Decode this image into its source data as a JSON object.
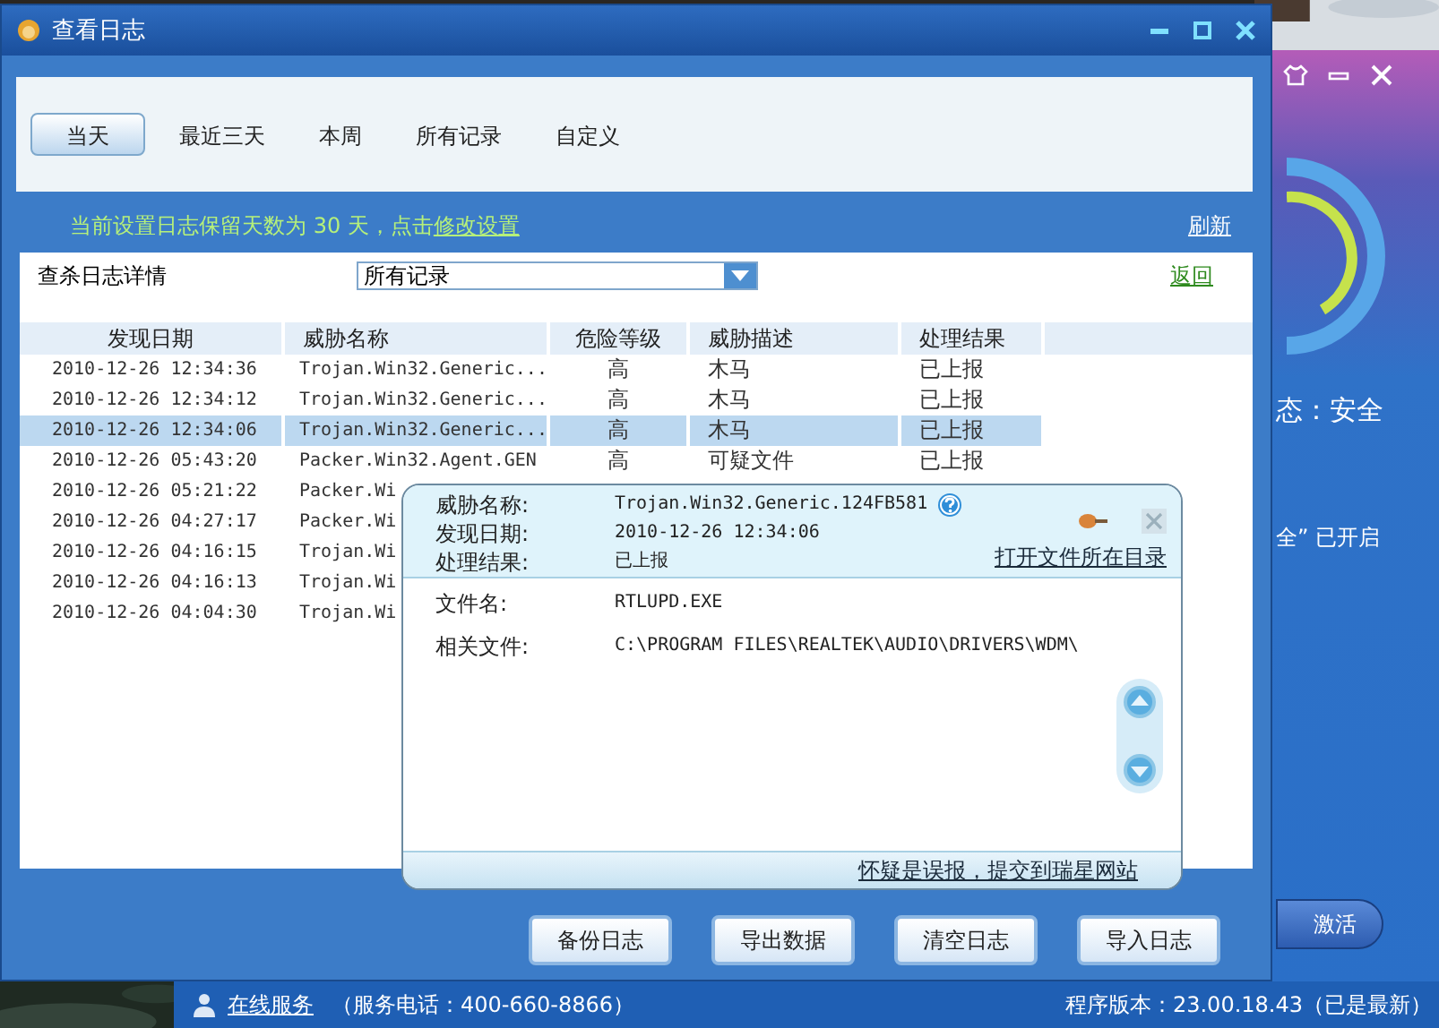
{
  "window": {
    "title": "查看日志"
  },
  "tabs": [
    {
      "label": "当天",
      "selected": true
    },
    {
      "label": "最近三天",
      "selected": false
    },
    {
      "label": "本周",
      "selected": false
    },
    {
      "label": "所有记录",
      "selected": false
    },
    {
      "label": "自定义",
      "selected": false
    }
  ],
  "notice": {
    "text": "当前设置日志保留天数为 30 天，点击",
    "link": "修改设置"
  },
  "refresh_link": "刷新",
  "filter": {
    "label": "查杀日志详情",
    "value": "所有记录"
  },
  "back_link": "返回",
  "table": {
    "columns": [
      "发现日期",
      "威胁名称",
      "危险等级",
      "威胁描述",
      "处理结果"
    ],
    "rows": [
      {
        "cells": [
          "2010-12-26 12:34:36",
          "Trojan.Win32.Generic...",
          "高",
          "木马",
          "已上报"
        ],
        "selected": false
      },
      {
        "cells": [
          "2010-12-26 12:34:12",
          "Trojan.Win32.Generic...",
          "高",
          "木马",
          "已上报"
        ],
        "selected": false
      },
      {
        "cells": [
          "2010-12-26 12:34:06",
          "Trojan.Win32.Generic...",
          "高",
          "木马",
          "已上报"
        ],
        "selected": true
      },
      {
        "cells": [
          "2010-12-26 05:43:20",
          "Packer.Win32.Agent.GEN",
          "高",
          "可疑文件",
          "已上报"
        ],
        "selected": false
      },
      {
        "cells": [
          "2010-12-26 05:21:22",
          "Packer.Wi"
        ],
        "selected": false
      },
      {
        "cells": [
          "2010-12-26 04:27:17",
          "Packer.Wi"
        ],
        "selected": false
      },
      {
        "cells": [
          "2010-12-26 04:16:15",
          "Trojan.Wi"
        ],
        "selected": false
      },
      {
        "cells": [
          "2010-12-26 04:16:13",
          "Trojan.Wi"
        ],
        "selected": false
      },
      {
        "cells": [
          "2010-12-26 04:04:30",
          "Trojan.Wi"
        ],
        "selected": false
      }
    ]
  },
  "popup": {
    "summary": [
      {
        "label": "威胁名称:",
        "value": "Trojan.Win32.Generic.124FB581"
      },
      {
        "label": "发现日期:",
        "value": "2010-12-26 12:34:06"
      },
      {
        "label": "处理结果:",
        "value": "已上报"
      }
    ],
    "open_folder_link": "打开文件所在目录",
    "details": [
      {
        "label": "文件名:",
        "value": "RTLUPD.EXE"
      },
      {
        "label": "相关文件:",
        "value": "C:\\PROGRAM FILES\\REALTEK\\AUDIO\\DRIVERS\\WDM\\"
      }
    ],
    "report_link": "怀疑是误报，提交到瑞星网站"
  },
  "buttons": [
    "备份日志",
    "导出数据",
    "清空日志",
    "导入日志"
  ],
  "status_bar": {
    "service_link": "在线服务",
    "phone": "（服务电话：400-660-8866）",
    "version": "程序版本：23.00.18.43（已是最新）"
  },
  "background_app": {
    "status": "态：安全",
    "feature": "全” 已开启",
    "button": "激活"
  }
}
